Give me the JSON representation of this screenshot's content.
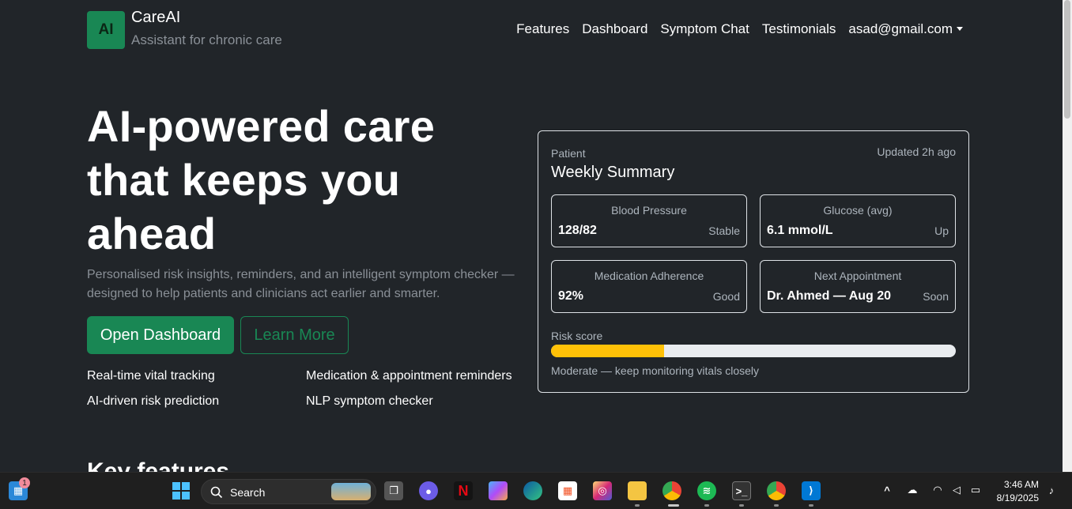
{
  "brand": {
    "logo_text": "AI",
    "name": "CareAI",
    "tagline": "Assistant for chronic care"
  },
  "nav": {
    "items": [
      "Features",
      "Dashboard",
      "Symptom Chat",
      "Testimonials"
    ],
    "user": "asad@gmail.com"
  },
  "hero": {
    "title": "AI-powered care that keeps you ahead",
    "description": "Personalised risk insights, reminders, and an intelligent symptom checker — designed to help patients and clinicians act earlier and smarter.",
    "primary_button": "Open Dashboard",
    "secondary_button": "Learn More",
    "features": [
      "Real-time vital tracking",
      "Medication & appointment reminders",
      "AI-driven risk prediction",
      "NLP symptom checker"
    ]
  },
  "summary": {
    "kicker": "Patient",
    "updated": "Updated 2h ago",
    "title": "Weekly Summary",
    "metrics": [
      {
        "label": "Blood Pressure",
        "value": "128/82",
        "status": "Stable"
      },
      {
        "label": "Glucose (avg)",
        "value": "6.1 mmol/L",
        "status": "Up"
      },
      {
        "label": "Medication Adherence",
        "value": "92%",
        "status": "Good"
      },
      {
        "label": "Next Appointment",
        "value": "Dr. Ahmed — Aug 20",
        "status": "Soon"
      }
    ],
    "risk": {
      "label": "Risk score",
      "percent": 28,
      "note": "Moderate — keep monitoring vitals closely",
      "color": "#ffc107"
    }
  },
  "section": {
    "partial_title": "Key features"
  },
  "taskbar": {
    "widgets_badge": "1",
    "search_label": "Search",
    "time": "3:46 AM",
    "date": "8/19/2025"
  },
  "colors": {
    "accent": "#198754",
    "background": "#212529"
  }
}
